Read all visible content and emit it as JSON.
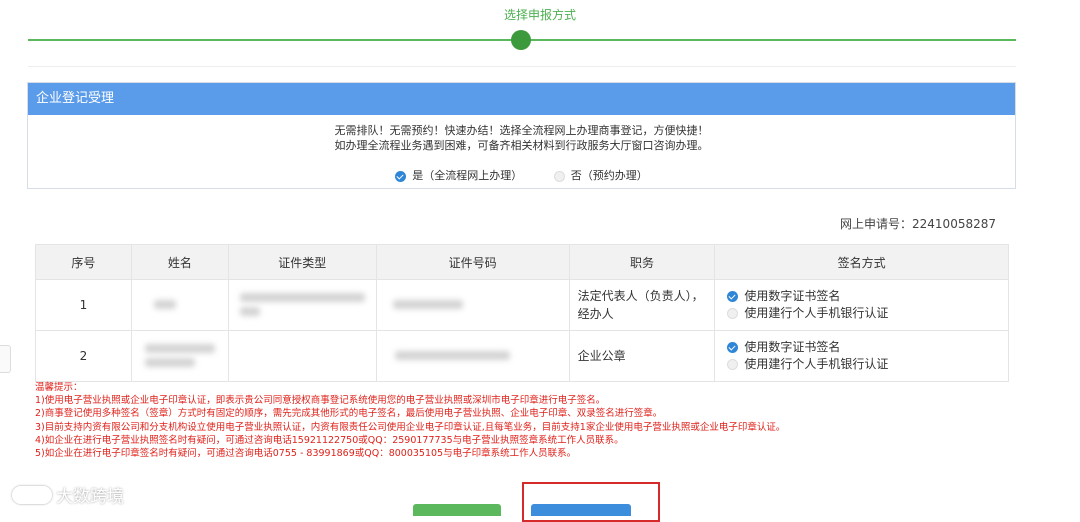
{
  "step": {
    "title": "选择申报方式"
  },
  "panel": {
    "title": "企业登记受理",
    "notice_line1": "无需排队！无需预约！快速办结！选择全流程网上办理商事登记，方便快捷！",
    "notice_line2": "如办理全流程业务遇到困难，可备齐相关材料到行政服务大厅窗口咨询办理。",
    "option_yes": "是（全流程网上办理）",
    "option_no": "否（预约办理）",
    "selected": "yes"
  },
  "application": {
    "label": "网上申请号：",
    "number": "22410058287"
  },
  "table": {
    "headers": [
      "序号",
      "姓名",
      "证件类型",
      "证件号码",
      "职务",
      "签名方式"
    ],
    "rows": [
      {
        "index": "1",
        "duty": "法定代表人（负责人），经办人",
        "sign_option1": "使用数字证书签名",
        "sign_option2": "使用建行个人手机银行认证"
      },
      {
        "index": "2",
        "duty": "企业公章",
        "sign_option1": "使用数字证书签名",
        "sign_option2": "使用建行个人手机银行认证"
      }
    ]
  },
  "tips": {
    "title": "温馨提示：",
    "items": [
      "1)使用电子营业执照或企业电子印章认证，即表示贵公司同意授权商事登记系统使用您的电子营业执照或深圳市电子印章进行电子签名。",
      "2)商事登记使用多种签名（签章）方式时有固定的顺序，需先完成其他形式的电子签名，最后使用电子营业执照、企业电子印章、双录签名进行签章。",
      "3)目前支持内资有限公司和分支机构设立使用电子营业执照认证，内资有限责任公司使用企业电子印章认证,且每笔业务，目前支持1家企业使用电子营业执照或企业电子印章认证。",
      "4)如企业在进行电子营业执照签名时有疑问，可通过咨询电话15921122750或QQ：2590177735与电子营业执照签章系统工作人员联系。",
      "5)如企业在进行电子印章签名时有疑问，可通过咨询电话0755 - 83991869或QQ：800035105与电子印章系统工作人员联系。"
    ]
  },
  "watermark": {
    "text": "大数跨境"
  },
  "colors": {
    "accent_green": "#5cb85c",
    "header_blue": "#5a9bea",
    "tip_red": "#e0221b",
    "check_blue": "#2f86d6"
  }
}
